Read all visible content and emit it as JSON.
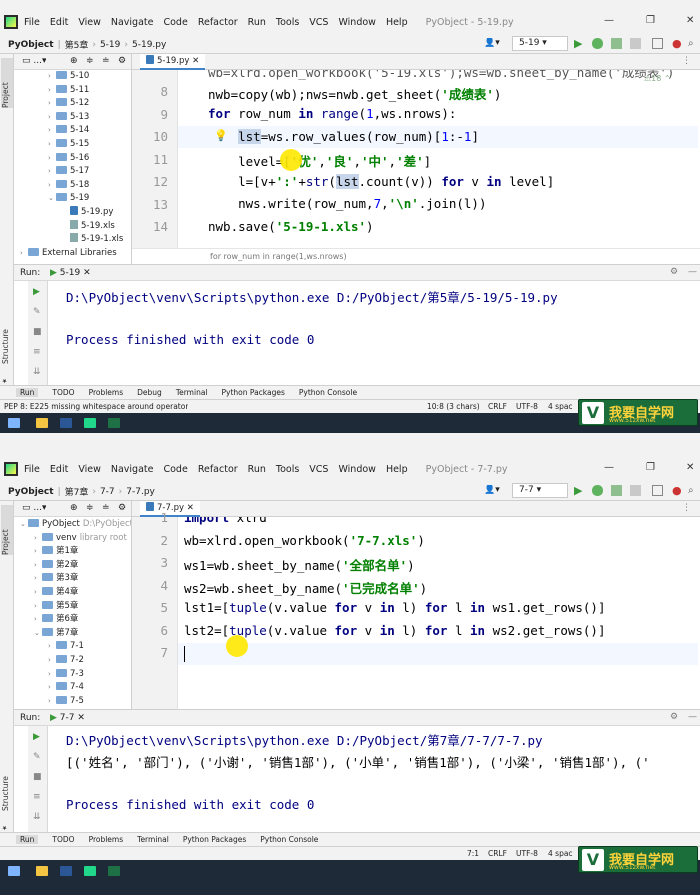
{
  "menu": [
    "File",
    "Edit",
    "View",
    "Navigate",
    "Code",
    "Refactor",
    "Run",
    "Tools",
    "VCS",
    "Window",
    "Help"
  ],
  "colors": {
    "accent": "#4083c9",
    "keyword": "#000080",
    "string": "#008000",
    "cursor_highlight": "#ffe800"
  },
  "w1": {
    "title": "PyObject - 5-19.py",
    "crumbs": [
      "PyObject",
      "第5章",
      "5-19",
      "5-19.py"
    ],
    "run_config": "5-19",
    "tab": "5-19.py",
    "tree": [
      {
        "label": "5-10",
        "depth": 2,
        "type": "folder",
        "arrow": "›"
      },
      {
        "label": "5-11",
        "depth": 2,
        "type": "folder",
        "arrow": "›"
      },
      {
        "label": "5-12",
        "depth": 2,
        "type": "folder",
        "arrow": "›"
      },
      {
        "label": "5-13",
        "depth": 2,
        "type": "folder",
        "arrow": "›"
      },
      {
        "label": "5-14",
        "depth": 2,
        "type": "folder",
        "arrow": "›"
      },
      {
        "label": "5-15",
        "depth": 2,
        "type": "folder",
        "arrow": "›"
      },
      {
        "label": "5-16",
        "depth": 2,
        "type": "folder",
        "arrow": "›"
      },
      {
        "label": "5-17",
        "depth": 2,
        "type": "folder",
        "arrow": "›"
      },
      {
        "label": "5-18",
        "depth": 2,
        "type": "folder",
        "arrow": "›"
      },
      {
        "label": "5-19",
        "depth": 2,
        "type": "folder",
        "arrow": "⌄"
      },
      {
        "label": "5-19.py",
        "depth": 3,
        "type": "py",
        "arrow": ""
      },
      {
        "label": "5-19.xls",
        "depth": 3,
        "type": "xls",
        "arrow": ""
      },
      {
        "label": "5-19-1.xls",
        "depth": 3,
        "type": "xls",
        "arrow": ""
      },
      {
        "label": "External Libraries",
        "depth": 0,
        "type": "folder",
        "arrow": "›"
      }
    ],
    "line_numbers": [
      "8",
      "9",
      "10",
      "11",
      "12",
      "13",
      "14"
    ],
    "top_partial": "wb=xlrd.open_workbook('5-19.xls');ws=wb.sheet_by_name('成绩表')",
    "hint_count": "18",
    "hint_line": "for row_num in range(1,ws.nrows)",
    "run_label": "Run:",
    "run_tab": "5-19",
    "output": [
      "D:\\PyObject\\venv\\Scripts\\python.exe D:/PyObject/第5章/5-19/5-19.py",
      "",
      "Process finished with exit code 0"
    ],
    "bottom_tabs": [
      "Run",
      "TODO",
      "Problems",
      "Debug",
      "Terminal",
      "Python Packages",
      "Python Console"
    ],
    "status_left": "PEP 8: E225 missing whitespace around operator",
    "status_right": [
      "10:8 (3 chars)",
      "CRLF",
      "UTF-8",
      "4 spac"
    ]
  },
  "w2": {
    "title": "PyObject - 7-7.py",
    "crumbs": [
      "PyObject",
      "第7章",
      "7-7",
      "7-7.py"
    ],
    "run_config": "7-7",
    "tab": "7-7.py",
    "tree": [
      {
        "label": "PyObject",
        "extra": "D:\\PyObject",
        "depth": 0,
        "type": "folder",
        "arrow": "⌄"
      },
      {
        "label": "venv",
        "extra": "library root",
        "depth": 1,
        "type": "folder",
        "arrow": "›"
      },
      {
        "label": "第1章",
        "depth": 1,
        "type": "folder",
        "arrow": "›"
      },
      {
        "label": "第2章",
        "depth": 1,
        "type": "folder",
        "arrow": "›"
      },
      {
        "label": "第3章",
        "depth": 1,
        "type": "folder",
        "arrow": "›"
      },
      {
        "label": "第4章",
        "depth": 1,
        "type": "folder",
        "arrow": "›"
      },
      {
        "label": "第5章",
        "depth": 1,
        "type": "folder",
        "arrow": "›"
      },
      {
        "label": "第6章",
        "depth": 1,
        "type": "folder",
        "arrow": "›"
      },
      {
        "label": "第7章",
        "depth": 1,
        "type": "folder",
        "arrow": "⌄"
      },
      {
        "label": "7-1",
        "depth": 2,
        "type": "folder",
        "arrow": "›"
      },
      {
        "label": "7-2",
        "depth": 2,
        "type": "folder",
        "arrow": "›"
      },
      {
        "label": "7-3",
        "depth": 2,
        "type": "folder",
        "arrow": "›"
      },
      {
        "label": "7-4",
        "depth": 2,
        "type": "folder",
        "arrow": "›"
      },
      {
        "label": "7-5",
        "depth": 2,
        "type": "folder",
        "arrow": "›"
      }
    ],
    "line_numbers": [
      "1",
      "2",
      "3",
      "4",
      "5",
      "6",
      "7"
    ],
    "run_label": "Run:",
    "run_tab": "7-7",
    "output": [
      "D:\\PyObject\\venv\\Scripts\\python.exe D:/PyObject/第7章/7-7/7-7.py",
      "[('姓名', '部门'), ('小谢', '销售1部'), ('小单', '销售1部'), ('小梁', '销售1部'), ('",
      "",
      "Process finished with exit code 0"
    ],
    "bottom_tabs": [
      "Run",
      "TODO",
      "Problems",
      "Terminal",
      "Python Packages",
      "Python Console"
    ],
    "status_right": [
      "7:1",
      "CRLF",
      "UTF-8",
      "4 spac"
    ]
  },
  "side_labels": {
    "project": "Project",
    "structure": "Structure",
    "favorites": "Favorites"
  },
  "logo": {
    "big": "我要自学网",
    "small": "www.51zxw.net"
  }
}
